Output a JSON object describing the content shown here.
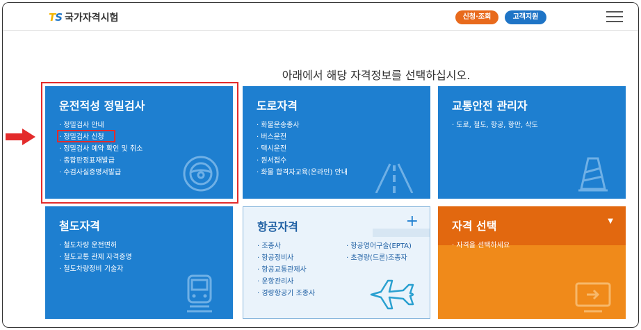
{
  "header": {
    "logo_mark_t": "T",
    "logo_mark_s": "S",
    "logo_text": "국가자격시험",
    "apply_button": "신청·조회",
    "support_button": "고객지원"
  },
  "heading": "아래에서 해당 자격정보를 선택하십시오.",
  "cards": {
    "driving": {
      "title": "운전적성 정밀검사",
      "items": [
        "정밀검사 안내",
        "정밀검사 신청",
        "정밀검사 예약 확인 및 취소",
        "종합판정표재발급",
        "수검사실증명서발급"
      ]
    },
    "road": {
      "title": "도로자격",
      "items": [
        "화물운송종사",
        "버스운전",
        "택시운전",
        "원서접수",
        "화물 합격자교육(온라인) 안내"
      ]
    },
    "safety": {
      "title": "교통안전 관리자",
      "items": [
        "도로, 철도, 항공, 항만, 삭도"
      ]
    },
    "rail": {
      "title": "철도자격",
      "items": [
        "철도차량 운전면허",
        "철도교통 관제 자격증명",
        "철도차량정비 기술자"
      ]
    },
    "aviation": {
      "title": "항공자격",
      "items_left": [
        "조종사",
        "항공정비사",
        "항공교통관제사",
        "운항관리사",
        "경량항공기 조종사"
      ],
      "items_right": [
        "항공영어구술(EPTA)",
        "초경량(드론)조종자"
      ],
      "plus": "+"
    },
    "select": {
      "title": "자격 선택",
      "caret": "▼",
      "items": [
        "자격을 선택하세요"
      ]
    }
  },
  "colors": {
    "card_blue": "#1e7fd0",
    "card_orange": "#f08a1a",
    "highlight_red": "#e32b2b",
    "apply_orange": "#e86a1c",
    "support_blue": "#1e74c6"
  }
}
